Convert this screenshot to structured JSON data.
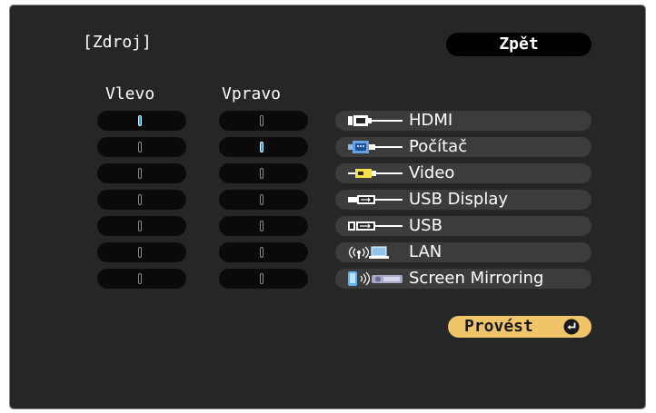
{
  "header": {
    "title": "[Zdroj]",
    "back_label": "Zpět"
  },
  "columns": {
    "left_label": "Vlevo",
    "right_label": "Vpravo"
  },
  "sources": [
    {
      "label": "HDMI",
      "icon": "hdmi-icon"
    },
    {
      "label": "Počítač",
      "icon": "computer-vga-icon"
    },
    {
      "label": "Video",
      "icon": "video-rca-icon"
    },
    {
      "label": "USB Display",
      "icon": "usb-display-icon"
    },
    {
      "label": "USB",
      "icon": "usb-icon"
    },
    {
      "label": "LAN",
      "icon": "lan-icon"
    },
    {
      "label": "Screen Mirroring",
      "icon": "screen-mirroring-icon"
    }
  ],
  "selection": {
    "left": "HDMI",
    "right": "Počítač"
  },
  "footer": {
    "execute_label": "Provést",
    "execute_icon": "enter-icon"
  },
  "colors": {
    "background": "#262626",
    "selected": "#1aa0ff",
    "execute": "#f0c469",
    "pill": "#3c3c3c"
  }
}
